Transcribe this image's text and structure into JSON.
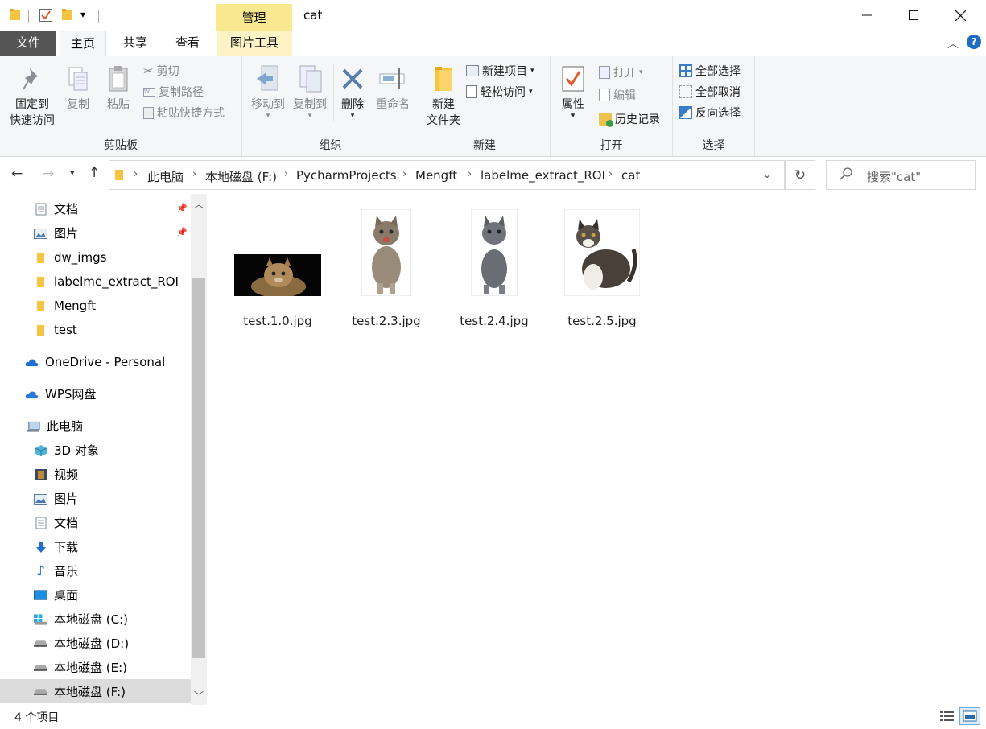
{
  "window": {
    "title": "cat",
    "manage_tab": "管理"
  },
  "tabs": {
    "file": "文件",
    "home": "主页",
    "share": "共享",
    "view": "查看",
    "picture_tools": "图片工具"
  },
  "ribbon": {
    "clipboard": {
      "label": "剪贴板",
      "pin_line1": "固定到",
      "pin_line2": "快速访问",
      "copy": "复制",
      "paste": "粘贴",
      "cut": "剪切",
      "copy_path": "复制路径",
      "paste_shortcut": "粘贴快捷方式"
    },
    "organize": {
      "label": "组织",
      "move_to": "移动到",
      "copy_to": "复制到",
      "delete": "删除",
      "rename": "重命名"
    },
    "new": {
      "label": "新建",
      "new_folder_line1": "新建",
      "new_folder_line2": "文件夹",
      "new_item": "新建项目",
      "easy_access": "轻松访问"
    },
    "open": {
      "label": "打开",
      "properties": "属性",
      "open": "打开",
      "edit": "编辑",
      "history": "历史记录"
    },
    "select": {
      "label": "选择",
      "select_all": "全部选择",
      "select_none": "全部取消",
      "invert": "反向选择"
    }
  },
  "breadcrumb": [
    "此电脑",
    "本地磁盘 (F:)",
    "PycharmProjects",
    "Mengft",
    "labelme_extract_ROI",
    "cat"
  ],
  "search": {
    "placeholder": "搜索\"cat\""
  },
  "sidebar": {
    "quick": [
      {
        "label": "文档",
        "icon": "document-icon",
        "pinned": true
      },
      {
        "label": "图片",
        "icon": "picture-icon",
        "pinned": true
      },
      {
        "label": "dw_imgs",
        "icon": "folder-icon"
      },
      {
        "label": "labelme_extract_ROI",
        "icon": "folder-icon"
      },
      {
        "label": "Mengft",
        "icon": "folder-icon"
      },
      {
        "label": "test",
        "icon": "folder-icon"
      }
    ],
    "onedrive": "OneDrive - Personal",
    "wps": "WPS网盘",
    "thispc": "此电脑",
    "pc_items": [
      {
        "label": "3D 对象",
        "icon": "3d-objects-icon"
      },
      {
        "label": "视频",
        "icon": "video-icon"
      },
      {
        "label": "图片",
        "icon": "picture-icon"
      },
      {
        "label": "文档",
        "icon": "document-icon"
      },
      {
        "label": "下载",
        "icon": "download-icon"
      },
      {
        "label": "音乐",
        "icon": "music-icon"
      },
      {
        "label": "桌面",
        "icon": "desktop-icon"
      },
      {
        "label": "本地磁盘 (C:)",
        "icon": "windows-drive-icon"
      },
      {
        "label": "本地磁盘 (D:)",
        "icon": "drive-icon"
      },
      {
        "label": "本地磁盘 (E:)",
        "icon": "drive-icon"
      },
      {
        "label": "本地磁盘 (F:)",
        "icon": "drive-icon",
        "selected": true
      }
    ]
  },
  "files": [
    {
      "name": "test.1.0.jpg"
    },
    {
      "name": "test.2.3.jpg"
    },
    {
      "name": "test.2.4.jpg"
    },
    {
      "name": "test.2.5.jpg"
    }
  ],
  "status": {
    "count": "4 个项目"
  },
  "colors": {
    "manage_tab_bg": "#f9e88f",
    "file_tab_bg": "#555555",
    "selected_nav_bg": "#dcdcdc",
    "folder_yellow": "#f6c343"
  }
}
